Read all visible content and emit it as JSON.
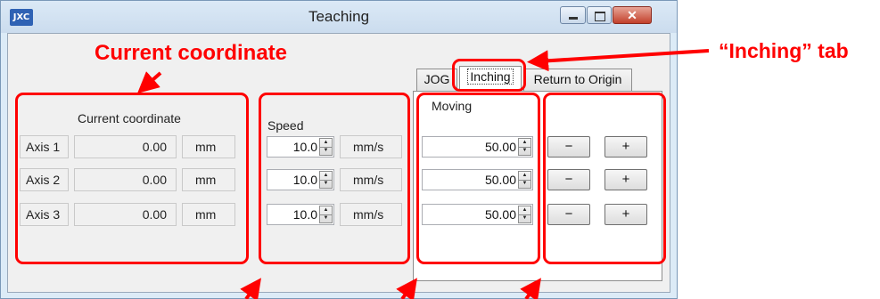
{
  "window": {
    "icon_text": "JXC",
    "title": "Teaching"
  },
  "coordinate_panel": {
    "header": "Current coordinate",
    "rows": [
      {
        "axis": "Axis 1",
        "value": "0.00",
        "unit": "mm"
      },
      {
        "axis": "Axis 2",
        "value": "0.00",
        "unit": "mm"
      },
      {
        "axis": "Axis 3",
        "value": "0.00",
        "unit": "mm"
      }
    ]
  },
  "speed_panel": {
    "header": "Speed",
    "rows": [
      {
        "value": "10.0",
        "unit": "mm/s"
      },
      {
        "value": "10.0",
        "unit": "mm/s"
      },
      {
        "value": "10.0",
        "unit": "mm/s"
      }
    ]
  },
  "tabs": [
    "JOG",
    "Inching",
    "Return to Origin"
  ],
  "active_tab": "Inching",
  "moving_panel": {
    "header": "Moving",
    "values": [
      "50.00",
      "50.00",
      "50.00"
    ]
  },
  "buttons": {
    "minus": "−",
    "plus": "+"
  },
  "annotations": {
    "current_coordinate": "Current coordinate",
    "inching_tab": "“Inching” tab",
    "color": "#ff0000"
  }
}
